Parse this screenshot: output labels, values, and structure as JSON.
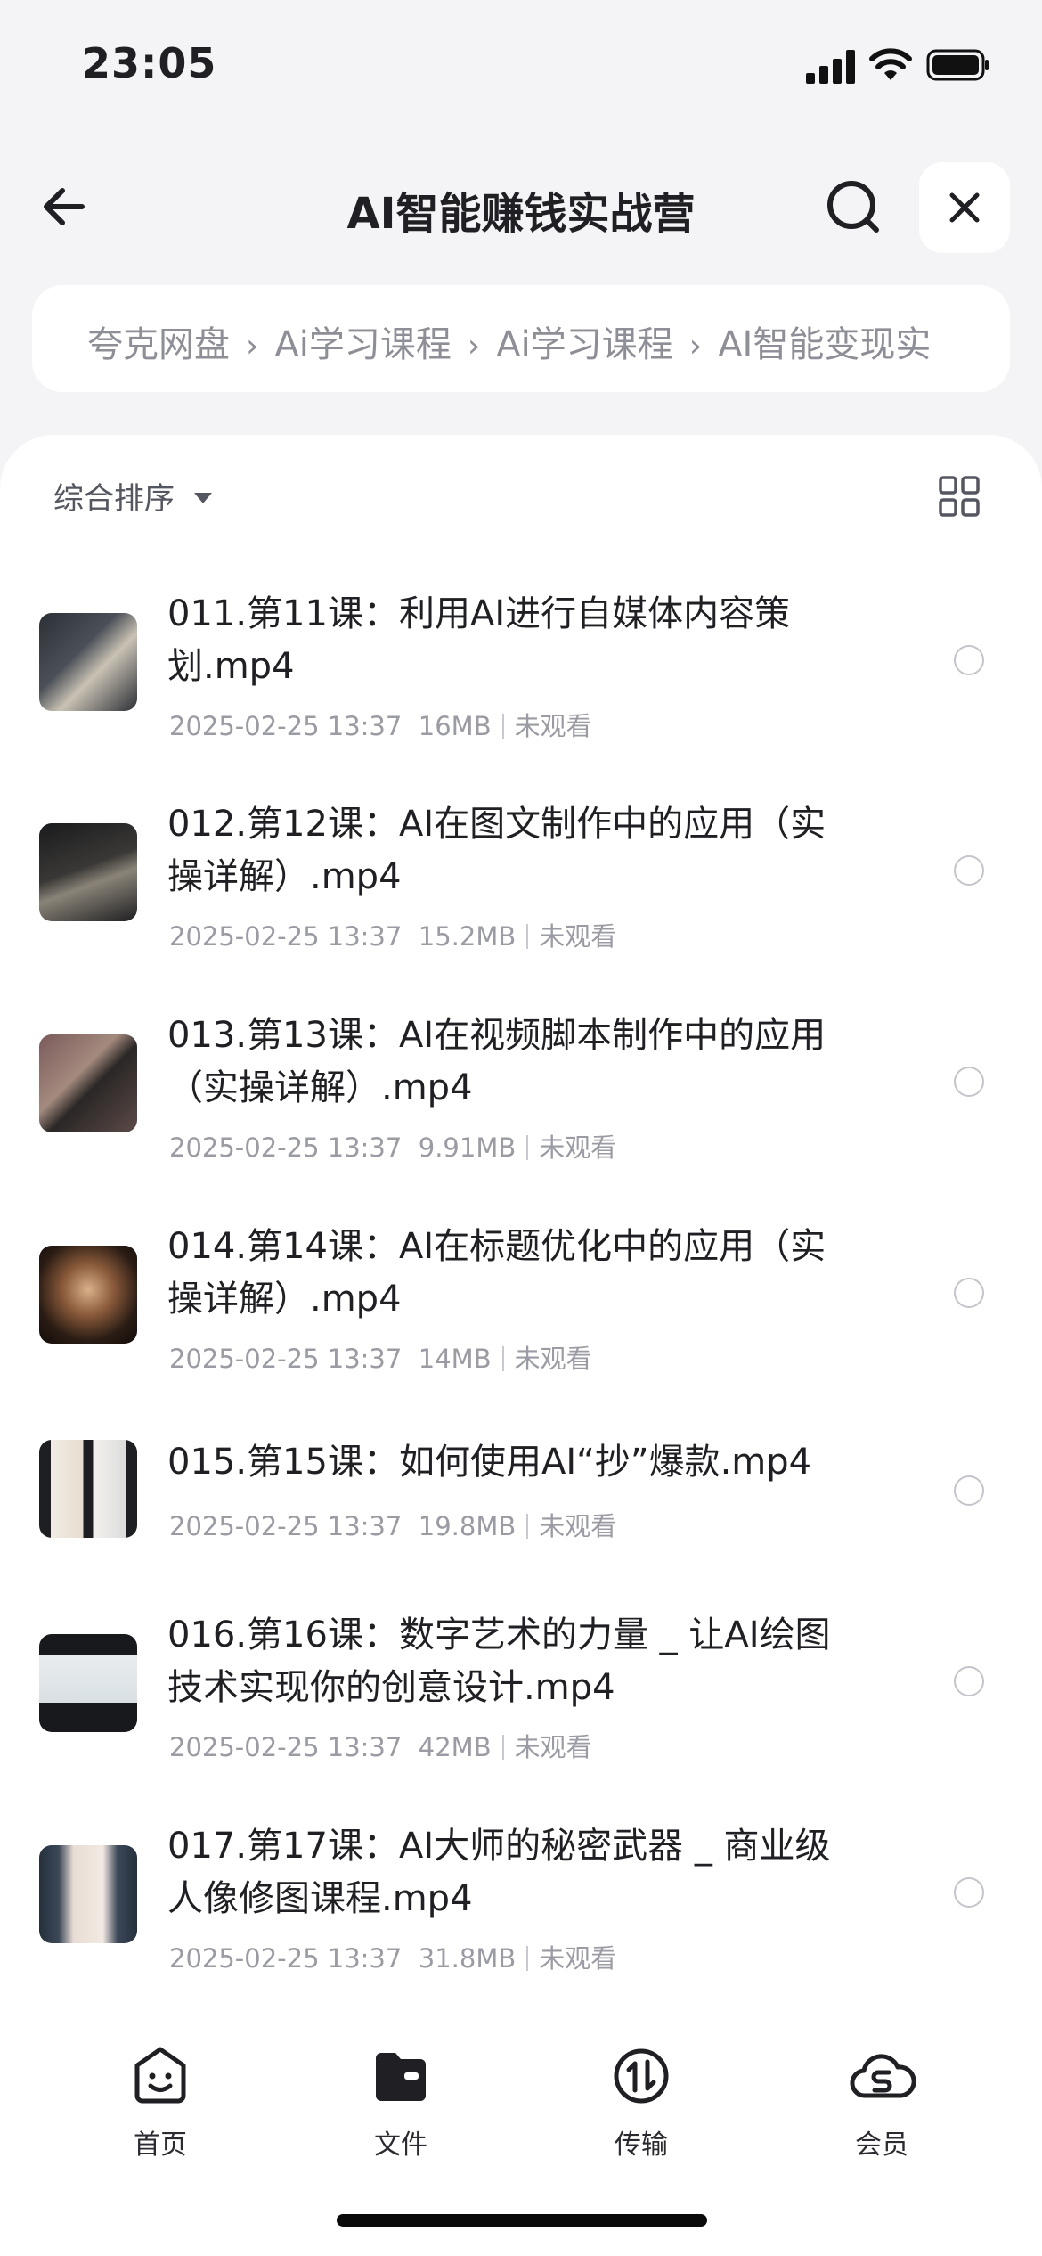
{
  "status": {
    "time": "23:05"
  },
  "header": {
    "title": "AI智能赚钱实战营"
  },
  "breadcrumb": [
    "夸克网盘",
    "Ai学习课程",
    "Ai学习课程",
    "AI智能变现实"
  ],
  "toolbar": {
    "sort_label": "综合排序"
  },
  "files": [
    {
      "title": "011.第11课：利用AI进行自媒体内容策划.mp4",
      "date": "2025-02-25 13:37",
      "size": "16MB",
      "status": "未观看"
    },
    {
      "title": "012.第12课：AI在图文制作中的应用（实操详解）.mp4",
      "date": "2025-02-25 13:37",
      "size": "15.2MB",
      "status": "未观看"
    },
    {
      "title": "013.第13课：AI在视频脚本制作中的应用（实操详解）.mp4",
      "date": "2025-02-25 13:37",
      "size": "9.91MB",
      "status": "未观看"
    },
    {
      "title": "014.第14课：AI在标题优化中的应用（实操详解）.mp4",
      "date": "2025-02-25 13:37",
      "size": "14MB",
      "status": "未观看"
    },
    {
      "title": "015.第15课：如何使用AI“抄”爆款.mp4",
      "date": "2025-02-25 13:37",
      "size": "19.8MB",
      "status": "未观看"
    },
    {
      "title": "016.第16课：数字艺术的力量 _ 让AI绘图技术实现你的创意设计.mp4",
      "date": "2025-02-25 13:37",
      "size": "42MB",
      "status": "未观看"
    },
    {
      "title": "017.第17课：AI大师的秘密武器 _ 商业级人像修图课程.mp4",
      "date": "2025-02-25 13:37",
      "size": "31.8MB",
      "status": "未观看"
    }
  ],
  "tabs": [
    "首页",
    "文件",
    "传输",
    "会员"
  ],
  "icons": {
    "back": "arrow-left-icon",
    "search": "search-icon",
    "close": "close-icon",
    "grid": "grid-view-icon",
    "home": "smile-face-icon",
    "files": "folder-icon",
    "transfer": "transfer-icon",
    "member": "cloud-s-icon"
  }
}
